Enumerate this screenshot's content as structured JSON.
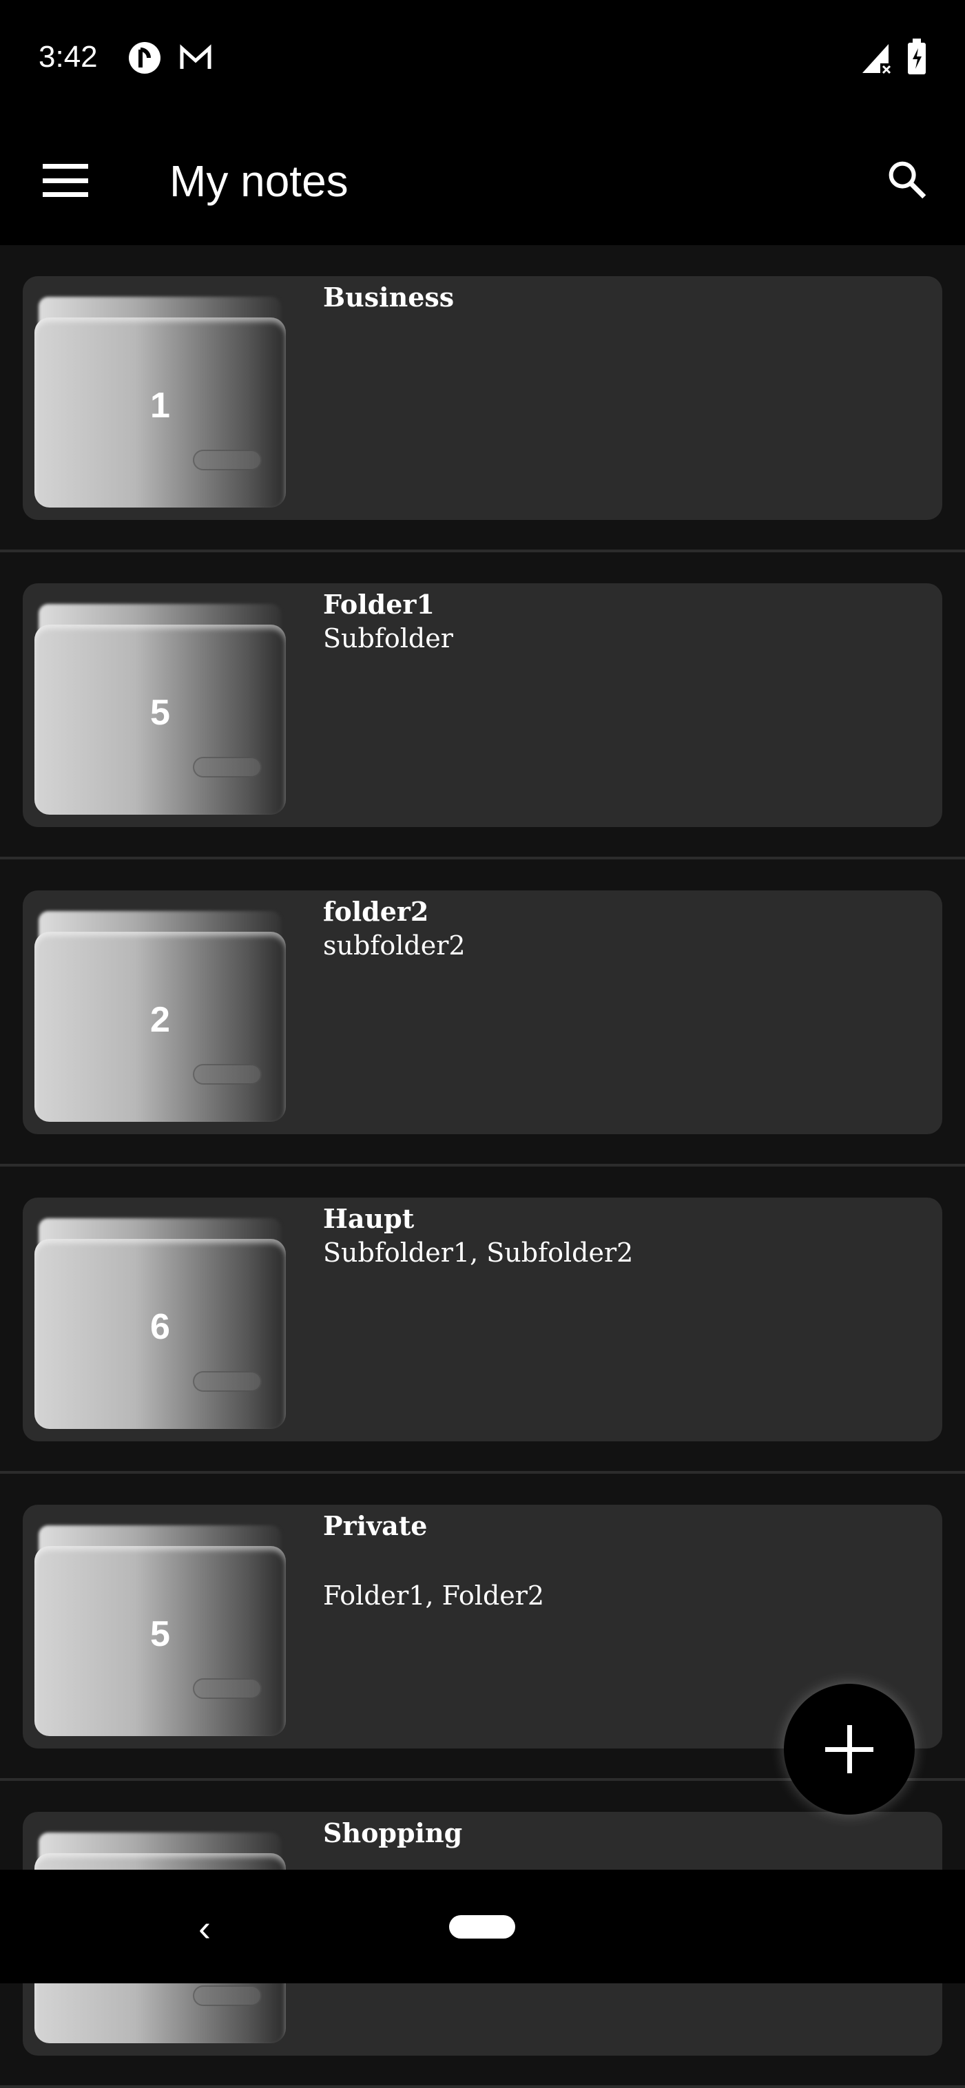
{
  "status_bar": {
    "time": "3:42",
    "icons": [
      "pocket-casts-icon",
      "gmail-icon",
      "signal-no-data-icon",
      "battery-charging-icon"
    ]
  },
  "app_bar": {
    "title": "My notes",
    "menu_icon": "hamburger-menu-icon",
    "search_icon": "search-icon"
  },
  "folders": [
    {
      "name": "Business",
      "subtitle": "",
      "count": "1"
    },
    {
      "name": "Folder1",
      "subtitle": "Subfolder",
      "count": "5"
    },
    {
      "name": "folder2",
      "subtitle": "subfolder2",
      "count": "2"
    },
    {
      "name": "Haupt",
      "subtitle": "Subfolder1, Subfolder2",
      "count": "6"
    },
    {
      "name": "Private",
      "subtitle": "Folder1, Folder2",
      "count": "5"
    },
    {
      "name": "Shopping",
      "subtitle": "",
      "count": ""
    }
  ],
  "fab": {
    "icon": "plus-icon"
  },
  "nav_bar": {
    "back_icon": "back-chevron-icon",
    "home_icon": "home-pill-icon"
  }
}
